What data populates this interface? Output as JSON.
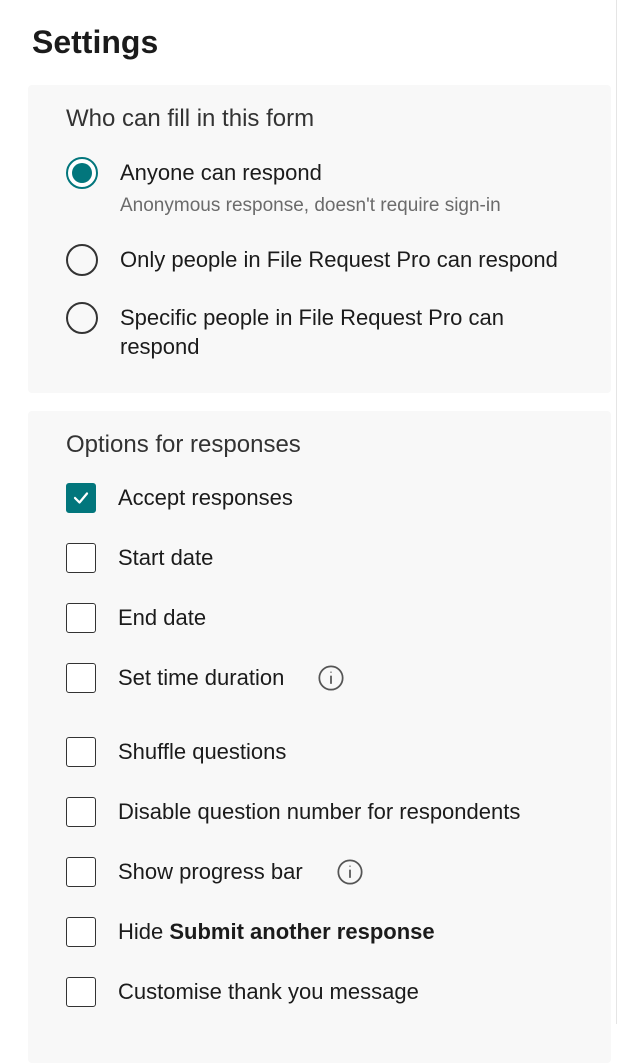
{
  "title": "Settings",
  "whoCanFill": {
    "heading": "Who can fill in this form",
    "options": [
      {
        "label": "Anyone can respond",
        "sub": "Anonymous response, doesn't require sign-in",
        "selected": true
      },
      {
        "label": "Only people in File Request Pro can respond",
        "sub": "",
        "selected": false
      },
      {
        "label": "Specific people in File Request Pro can respond",
        "sub": "",
        "selected": false
      }
    ]
  },
  "responseOptions": {
    "heading": "Options for responses",
    "items": {
      "accept": {
        "label": "Accept responses",
        "checked": true
      },
      "startDate": {
        "label": "Start date",
        "checked": false
      },
      "endDate": {
        "label": "End date",
        "checked": false
      },
      "timeDuration": {
        "label": "Set time duration",
        "checked": false,
        "info": true
      },
      "shuffle": {
        "label": "Shuffle questions",
        "checked": false
      },
      "disableNumber": {
        "label": "Disable question number for respondents",
        "checked": false
      },
      "progressBar": {
        "label": "Show progress bar",
        "checked": false,
        "info": true
      },
      "hideSubmitPrefix": "Hide ",
      "hideSubmitBold": "Submit another response",
      "customThankYou": {
        "label": "Customise thank you message",
        "checked": false
      }
    }
  }
}
